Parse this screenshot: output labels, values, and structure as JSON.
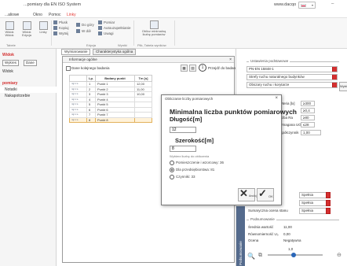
{
  "app": {
    "title": "...pomiary dla EN ISO System",
    "website": "www.dacqo",
    "language": "PL",
    "minimize_glyph": "–"
  },
  "menu": {
    "tabs": [
      {
        "label": "...aliowe"
      },
      {
        "label": "Okno"
      },
      {
        "label": "Pomoc"
      },
      {
        "label": "Linky",
        "active": true
      }
    ]
  },
  "ribbon": {
    "buttons": [
      {
        "label": "Widok\nWidok",
        "icon": "layout-icon"
      },
      {
        "label": "Widok\nEdycja",
        "icon": "layout-icon"
      },
      {
        "label": "Linky",
        "icon": "grid-icon"
      }
    ],
    "small_buttons": [
      {
        "label": "Plusk",
        "icon": "plus-icon"
      },
      {
        "label": "Kopiuj",
        "icon": "copy-icon"
      },
      {
        "label": "Wytnij",
        "icon": "cut-icon"
      },
      {
        "label": "Do góry",
        "icon": "arrow-up-icon"
      },
      {
        "label": "W dół",
        "icon": "arrow-down-icon"
      },
      {
        "label": "Pomiar",
        "icon": "measure-icon"
      },
      {
        "label": "Autouzupełnianie",
        "icon": "auto-fill-icon"
      },
      {
        "label": "Uwagi",
        "icon": "note-icon"
      }
    ],
    "big_right": {
      "label": "Oblicz minimalną\nliczbę pomiarów",
      "icon": "calculator-icon"
    },
    "groups": [
      "Tabele",
      "Edycja",
      "Wyniki",
      "Plik, Tabela wyników"
    ]
  },
  "left_panel": {
    "section_label": "Widok",
    "buttons": [
      "Wykres",
      "Dane"
    ],
    "items": [
      {
        "label": "Widok",
        "selected": false
      },
      {
        "label": "pomiary",
        "selected": false,
        "red": true
      },
      {
        "label": "Notatki",
        "selected": true
      },
      {
        "label": "Nakapotrzebie",
        "selected": false
      }
    ]
  },
  "center": {
    "tabs": [
      {
        "label": "Wymiarowanie",
        "active": true
      },
      {
        "label": "Charakterystyka ogólna",
        "active": false
      }
    ],
    "window_title": "Informacje ogólne",
    "add_to_list_label": "Dane kolejnego badania",
    "step_number": "1",
    "goto_label": "Przejdź do badania",
    "table": {
      "headers": [
        "",
        "Lp.",
        "Badany punkt",
        "Tm [s]"
      ],
      "rows": [
        {
          "icon": "ᵐᵍ⁻ˢ⁻ᵃ",
          "lp": "1",
          "point": "Punkt 1",
          "tm": "12,00",
          "selected": false
        },
        {
          "icon": "ᵐᵍ⁻ˢ⁻ᵃ",
          "lp": "2",
          "point": "Punkt 2",
          "tm": "11,00",
          "selected": false
        },
        {
          "icon": "ᵐᵍ⁻ˢ⁻ᵃ",
          "lp": "3",
          "point": "Punkt 3",
          "tm": "10,00",
          "selected": false
        },
        {
          "icon": "ᵐᵍ⁻ˢ⁻ᵃ",
          "lp": "4",
          "point": "Punkt 4",
          "tm": "",
          "selected": false
        },
        {
          "icon": "ᵐᵍ⁻ˢ⁻ᵃ",
          "lp": "5",
          "point": "Punkt 5",
          "tm": "",
          "selected": false
        },
        {
          "icon": "ᵐᵍ⁻ˢ⁻ᵃ",
          "lp": "6",
          "point": "Punkt 6",
          "tm": "",
          "selected": false
        },
        {
          "icon": "ᵐᵍ⁻ˢ⁻ᵃ",
          "lp": "7",
          "point": "Punkt 7",
          "tm": "",
          "selected": false
        },
        {
          "icon": "ᵐᵍ⁻ˢ⁻ᵃ",
          "lp": "8",
          "point": "Punkt 8",
          "tm": "",
          "selected": true
        }
      ]
    }
  },
  "right_panel": {
    "section1": "Ustawienia podstawowe",
    "norm_field": "PN-EN 15848-1",
    "field2": "Strefy ruchu naturalnego budynków",
    "field3": "Obszary ruchu i korytarze",
    "side_button": "Wybierz",
    "values": [
      {
        "label": "Kryteria [lx]",
        "value": "≥300"
      },
      {
        "label": "",
        "value": "≥0,4"
      },
      {
        "label": "Liczba Ra",
        "value": "≥80"
      },
      {
        "label": "Wymagana UGR",
        "value": "≤28"
      },
      {
        "label": "Współczynnik",
        "value": "1,00"
      }
    ],
    "combos": [
      {
        "value": "Spełnia"
      },
      {
        "value": "Spełnia"
      },
      {
        "value": "Spełnia"
      }
    ],
    "combo_label": "Sumaryczna ocena stanu",
    "section2": "Podsumowanie",
    "summary": [
      {
        "label": "Średnia wartość",
        "value": "11,00"
      },
      {
        "label": "Równomierność U₀",
        "value": "0,00"
      },
      {
        "label": "Ocena",
        "value": "Negatywna"
      }
    ],
    "vertical_tab": "Podsumowanie",
    "zoom_label": "1,0"
  },
  "dialog": {
    "title": "Obliczanie liczby pomiarowych",
    "heading": "Minimalna liczba punktów pomiarowych",
    "length_label": "Długość[m]",
    "length_value": "12",
    "width_label": "Szerokość[m]",
    "width_value": "8",
    "method_label": "Wybierz liczbę do obliczenia",
    "options": [
      {
        "label": "Pomieszczenie i wzorcowy: 36",
        "checked": false
      },
      {
        "label": "Dla przedsiębiorstwa: 81",
        "checked": true
      },
      {
        "label": "Czynniki: 33",
        "checked": false
      }
    ],
    "cancel_label": "Anuluj",
    "ok_label": "OK"
  }
}
